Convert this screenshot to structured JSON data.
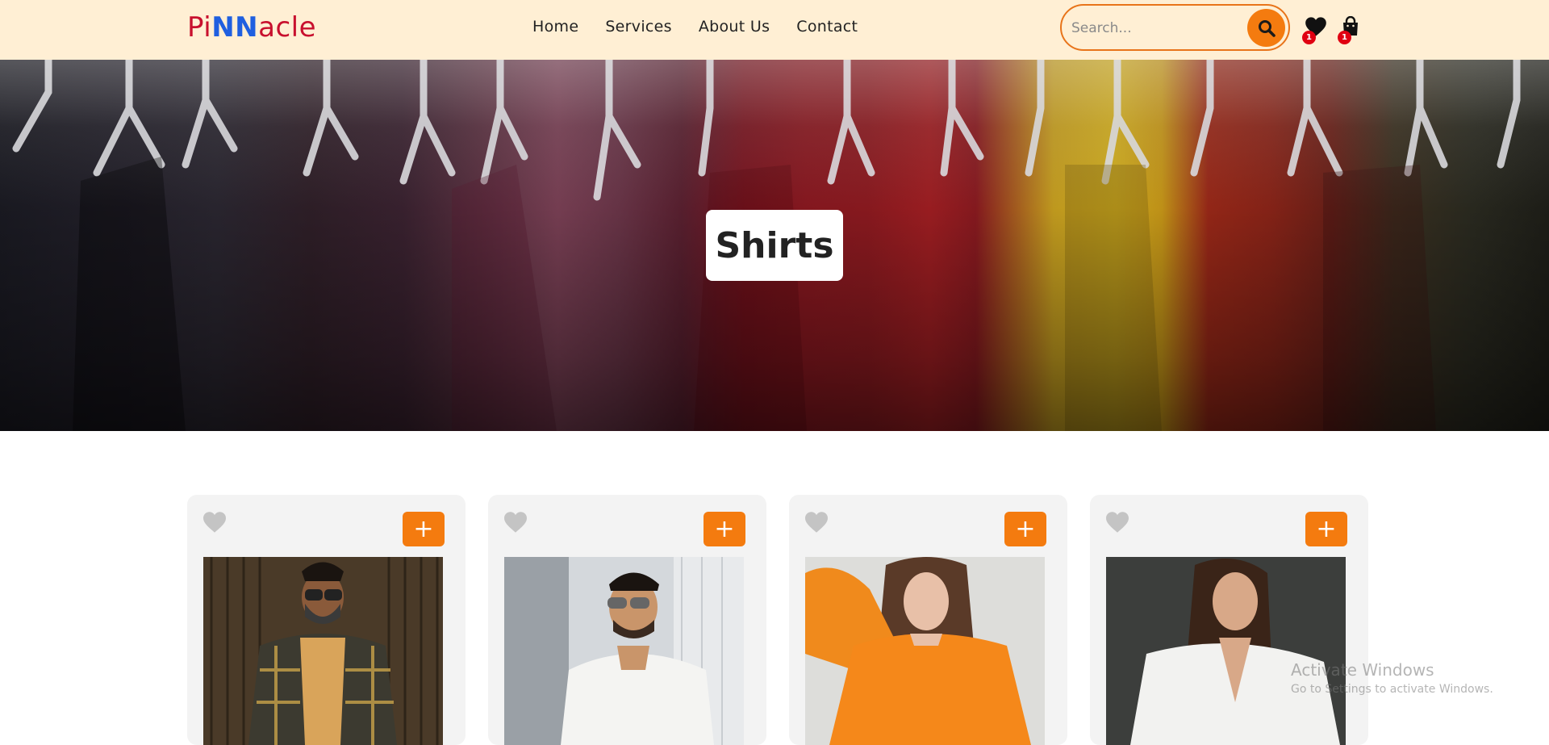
{
  "logo": {
    "part1": "Pi",
    "part2": "NN",
    "part3": "acle"
  },
  "nav": {
    "items": [
      "Home",
      "Services",
      "About Us",
      "Contact"
    ]
  },
  "search": {
    "placeholder": "Search..."
  },
  "header_icons": {
    "wishlist_count": "1",
    "cart_count": "1"
  },
  "hero": {
    "title": "Shirts"
  },
  "products": [
    {
      "add_label": "+"
    },
    {
      "add_label": "+"
    },
    {
      "add_label": "+"
    },
    {
      "add_label": "+"
    }
  ],
  "watermark": {
    "line1": "Activate Windows",
    "line2": "Go to Settings to activate Windows."
  },
  "colors": {
    "accent": "#f47b0f",
    "navbar_bg": "#ffefd4",
    "badge": "#e00012",
    "logo_red": "#c8102e",
    "logo_blue": "#1f5fe0"
  }
}
